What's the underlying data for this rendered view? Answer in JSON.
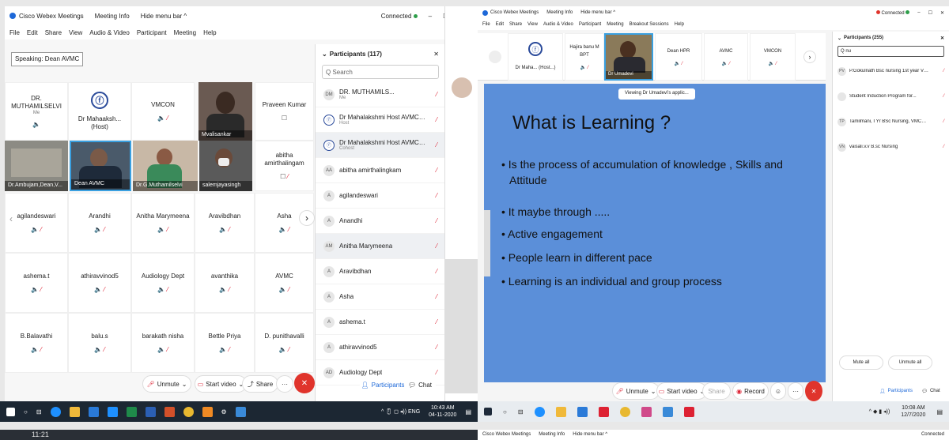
{
  "left": {
    "title": {
      "app": "Cisco Webex Meetings",
      "info": "Meeting Info",
      "hide": "Hide menu bar ^",
      "status": "Connected"
    },
    "menu": [
      "File",
      "Edit",
      "Share",
      "View",
      "Audio & Video",
      "Participant",
      "Meeting",
      "Help"
    ],
    "speaking": "Speaking: Dean AVMC",
    "tiles_row1": [
      {
        "name": "DR. MUTHAMILSELVI",
        "sub": "Me"
      },
      {
        "name": "Dr Mahaaksh... (Host)"
      },
      {
        "name": "VMCON"
      },
      {
        "name": "Mvalisankar"
      },
      {
        "name": "Praveen Kumar"
      }
    ],
    "tiles_row2": [
      {
        "name": "Dr.Ambujam,Dean,V..."
      },
      {
        "name": "Dean AVMC"
      },
      {
        "name": "Dr.G.Muthamilselvi"
      },
      {
        "name": "salemjayasingh"
      },
      {
        "name": "abitha amirthalingam"
      }
    ],
    "grid": [
      [
        "agilandeswari",
        "Arandhi",
        "Anitha Marymeena",
        "Aravibdhan",
        "Asha"
      ],
      [
        "ashema.t",
        "athiravvinod5",
        "Audiology Dept",
        "avanthika",
        "AVMC"
      ],
      [
        "B.Balavathi",
        "balu.s",
        "barakath nisha",
        "Bettle Priya",
        "D. punithavalli"
      ]
    ],
    "participants": {
      "header": "Participants (117)",
      "search": "Q Search",
      "rows": [
        {
          "av": "DM",
          "name": "DR. MUTHAMILS...",
          "sub": "Me"
        },
        {
          "av": "logo",
          "name": "Dr Mahalakshmi Host AVMC Scientif...",
          "sub": "Host"
        },
        {
          "av": "logo",
          "name": "Dr Mahalakshmi Host AVMC Scientif...",
          "sub": "Cohost"
        },
        {
          "av": "AA",
          "name": "abitha amirthalingkam",
          "sub": ""
        },
        {
          "av": "A",
          "name": "agilandeswari",
          "sub": ""
        },
        {
          "av": "A",
          "name": "Anandhi",
          "sub": ""
        },
        {
          "av": "AM",
          "name": "Anitha Marymeena",
          "sub": ""
        },
        {
          "av": "A",
          "name": "Aravibdhan",
          "sub": ""
        },
        {
          "av": "A",
          "name": "Asha",
          "sub": ""
        },
        {
          "av": "A",
          "name": "ashema.t",
          "sub": ""
        },
        {
          "av": "A",
          "name": "athiravvinod5",
          "sub": ""
        },
        {
          "av": "AD",
          "name": "Audiology Dept",
          "sub": ""
        }
      ]
    },
    "controls": {
      "unmute": "Unmute",
      "video": "Start video",
      "share": "Share",
      "participants": "Participants",
      "chat": "Chat"
    },
    "taskbar": {
      "time": "10:43 AM",
      "date": "04-11-2020",
      "lang": "ENG"
    }
  },
  "right": {
    "title": {
      "app": "Cisco Webex Meetings",
      "info": "Meeting Info",
      "hide": "Hide menu bar ^",
      "status": "Connected"
    },
    "menu": [
      "File",
      "Edit",
      "Share",
      "View",
      "Audio & Video",
      "Participant",
      "Meeting",
      "Breakout Sessions",
      "Help"
    ],
    "strip": [
      "Dr Maha... (Host...)",
      "Hajira banu M BPT",
      "Dr Umadevi",
      "Dean HPR",
      "AVMC",
      "VMCON"
    ],
    "viewing": "Viewing Dr Umadevi's applic...",
    "slide": {
      "title": "What is Learning ?",
      "bullets": [
        "Is the process of accumulation of knowledge , Skills and Attitude",
        "It maybe through .....",
        "Active engagement",
        "People learn in different pace",
        "Learning is an individual and group process"
      ]
    },
    "participants": {
      "header": "Participants (255)",
      "search": "Q nu",
      "rows": [
        {
          "av": "PV",
          "name": "P.Gokulnath Bsc nursing 1st year VMC..."
        },
        {
          "av": "",
          "name": "Student Induction Program for..."
        },
        {
          "av": "TP",
          "name": "Tamilmani, I Yr BSc Nursing, VMCON, P..."
        },
        {
          "av": "VN",
          "name": "vaisali.v.v B.sc Nursing"
        }
      ],
      "mute_all": "Mute all",
      "unmute_all": "Unmute all"
    },
    "controls": {
      "unmute": "Unmute",
      "video": "Start video",
      "share": "Share",
      "record": "Record",
      "participants": "Participants",
      "chat": "Chat"
    },
    "taskbar": {
      "time": "10:08 AM",
      "date": "12/7/2020"
    }
  },
  "bottom": {
    "time": "11:21",
    "status": "Connected"
  },
  "colors": {
    "slide_bg": "#5b8fd9",
    "accent": "#1d68d8",
    "red": "#e0342c",
    "taskbar": "#1c2733"
  }
}
